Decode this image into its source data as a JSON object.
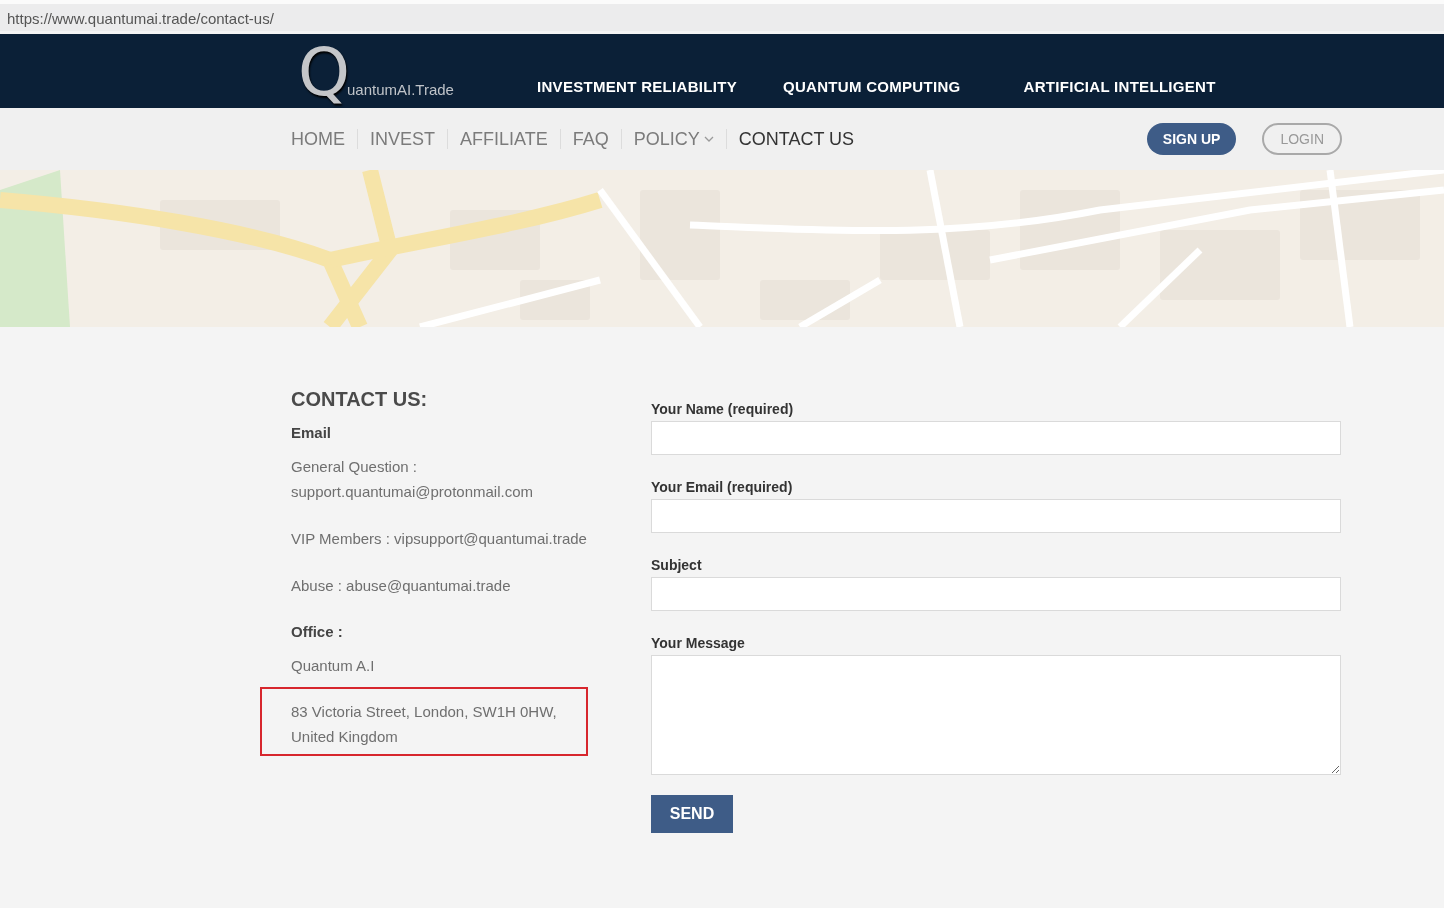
{
  "browser": {
    "url": "https://www.quantumai.trade/contact-us/"
  },
  "header": {
    "logo": {
      "mark": "Q",
      "text": "uantumAI.Trade"
    },
    "links": [
      "INVESTMENT RELIABILITY",
      "QUANTUM COMPUTING",
      "ARTIFICIAL INTELLIGENT"
    ]
  },
  "nav": {
    "items": [
      {
        "label": "HOME",
        "selected": false,
        "has_menu": false
      },
      {
        "label": "INVEST",
        "selected": false,
        "has_menu": false
      },
      {
        "label": "AFFILIATE",
        "selected": false,
        "has_menu": false
      },
      {
        "label": "FAQ",
        "selected": false,
        "has_menu": false
      },
      {
        "label": "POLICY",
        "selected": false,
        "has_menu": true
      },
      {
        "label": "CONTACT US",
        "selected": true,
        "has_menu": false
      }
    ],
    "buttons": [
      {
        "label": "SIGN UP",
        "kind": "primary"
      },
      {
        "label": "LOGIN",
        "kind": "outline"
      }
    ]
  },
  "contact": {
    "title": "CONTACT US:",
    "blocks": [
      {
        "kind": "heading",
        "text": "Email",
        "highlighted": false
      },
      {
        "kind": "text",
        "text": "General Question : support.quantumai@protonmail.com",
        "highlighted": false
      },
      {
        "kind": "text",
        "text": "VIP Members : vipsupport@quantumai.trade",
        "highlighted": false
      },
      {
        "kind": "text",
        "text": "Abuse : abuse@quantumai.trade",
        "highlighted": false
      },
      {
        "kind": "heading",
        "text": "Office :",
        "highlighted": false
      },
      {
        "kind": "text",
        "text": "Quantum A.I",
        "highlighted": false
      },
      {
        "kind": "text",
        "text": "83 Victoria Street, London, SW1H 0HW, United Kingdom",
        "highlighted": true
      }
    ]
  },
  "form": {
    "fields": [
      {
        "label": "Your Name (required)",
        "kind": "input"
      },
      {
        "label": "Your Email (required)",
        "kind": "input"
      },
      {
        "label": "Subject",
        "kind": "input"
      },
      {
        "label": "Your Message",
        "kind": "textarea"
      }
    ],
    "submit": "SEND"
  }
}
